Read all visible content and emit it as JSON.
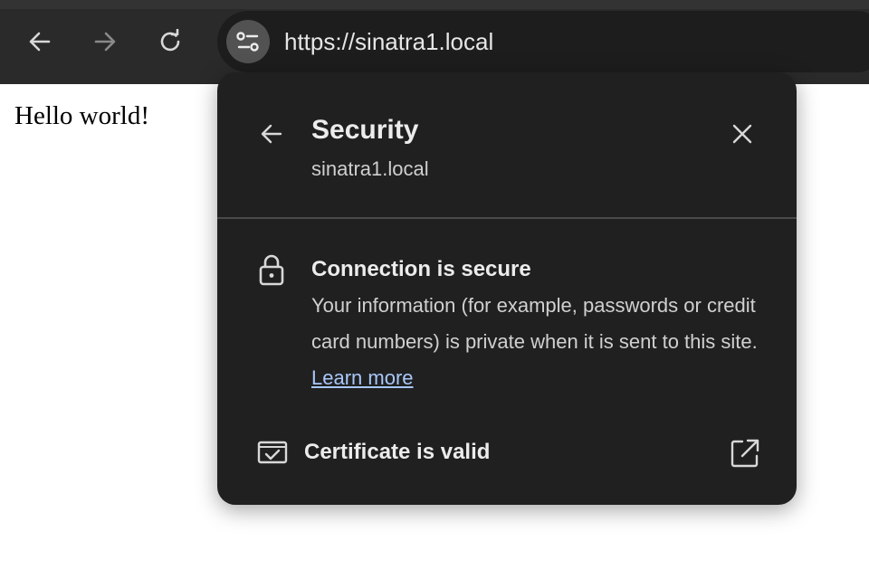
{
  "browser": {
    "url": "https://sinatra1.local",
    "nav": {
      "back_icon": "arrow-left-icon",
      "forward_icon": "arrow-right-icon",
      "reload_icon": "reload-icon",
      "site_info_icon": "tune-icon"
    }
  },
  "page": {
    "body_text": "Hello world!"
  },
  "security_popup": {
    "title": "Security",
    "subtitle": "sinatra1.local",
    "connection": {
      "title": "Connection is secure",
      "description": "Your information (for example, passwords or credit card numbers) is private when it is sent to this site.",
      "learn_more": "Learn more"
    },
    "certificate": {
      "label": "Certificate is valid"
    }
  },
  "colors": {
    "toolbar": "#2a2a2a",
    "omnibox": "#1d1d1d",
    "popup_bg": "#202020",
    "link": "#a8c7fa"
  }
}
